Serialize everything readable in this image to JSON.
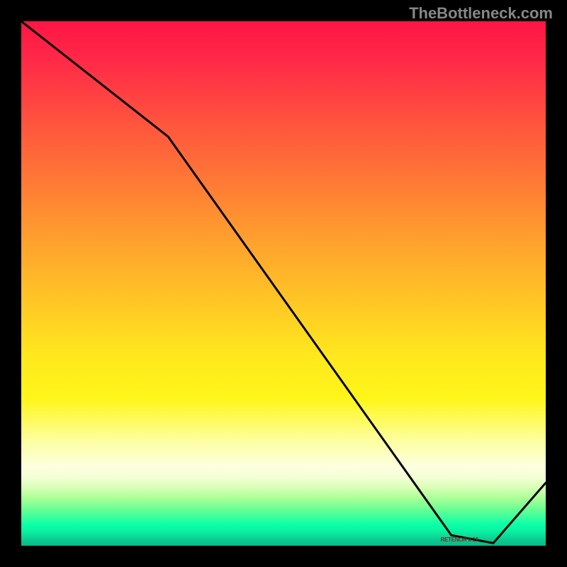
{
  "watermark": "TheBottleneck.com",
  "chart_data": {
    "type": "line",
    "title": "",
    "xlabel": "",
    "ylabel": "",
    "ylim": [
      0,
      100
    ],
    "xlim": [
      0,
      100
    ],
    "x": [
      0,
      28,
      82,
      90,
      100
    ],
    "values": [
      100,
      78,
      2,
      0.5,
      12
    ],
    "background_gradient": "red-yellow-green vertical gradient (red=top high values, green=bottom low values)",
    "annotations": [
      {
        "text": "RETENOR II-19",
        "x": 84,
        "y": 1
      }
    ]
  }
}
